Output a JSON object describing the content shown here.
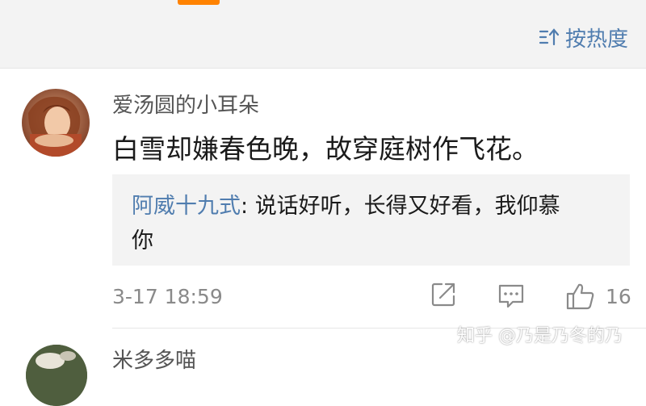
{
  "sort": {
    "label": "按热度",
    "icon": "sort-icon"
  },
  "colors": {
    "accent": "#ff8200",
    "link": "#507daf",
    "muted": "#8a8a8a"
  },
  "comment": {
    "username": "爱汤圆的小耳朵",
    "text": "白雪却嫌春色晚，故穿庭树作飞花。",
    "reply": {
      "author": "阿威十九式",
      "separator": ": ",
      "text_line1": "说话好听，长得又好看，我仰慕",
      "text_line2": "你"
    },
    "timestamp": "3-17 18:59",
    "like_count": "16",
    "actions": [
      "repost-icon",
      "comment-icon",
      "like-icon"
    ]
  },
  "next_comment": {
    "username": "米多多喵"
  },
  "watermark": "知乎 @乃是乃冬的乃"
}
